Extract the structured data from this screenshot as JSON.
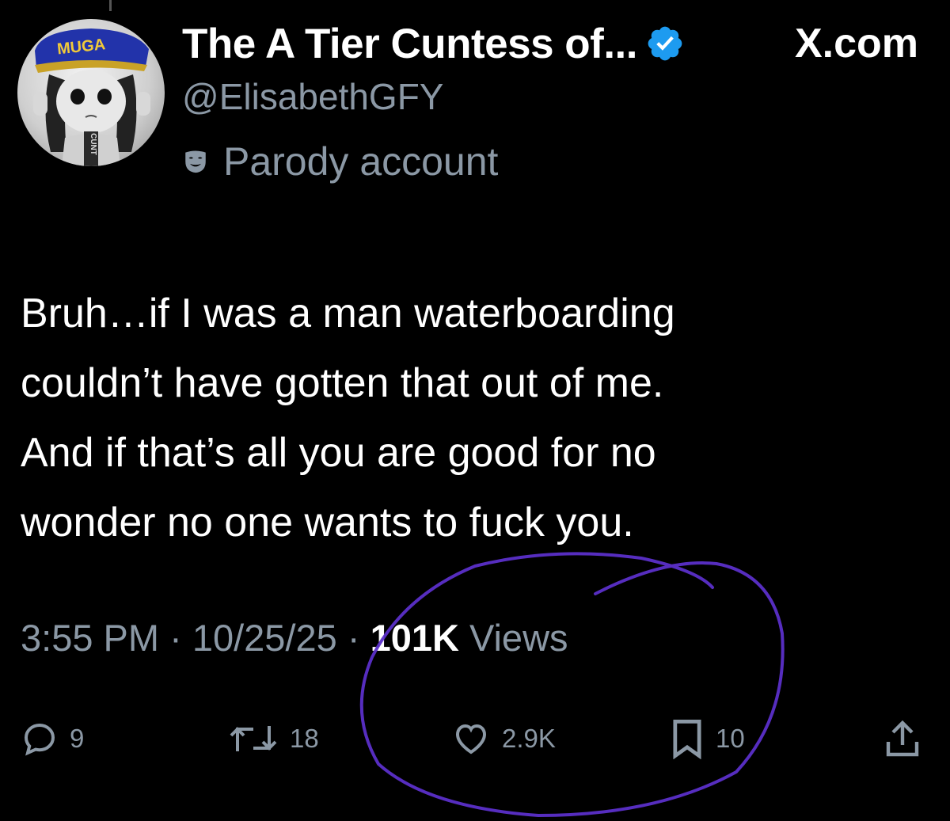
{
  "author": {
    "display_name": "The A Tier Cuntess of...",
    "verified_icon": "verified-badge-icon",
    "handle": "@ElisabethGFY",
    "label": "Parody account",
    "label_icon": "parody-mask-icon",
    "avatar_cap_text": "MUGA",
    "avatar_shirt_text": "CUNT"
  },
  "site": {
    "name": "X.com"
  },
  "tweet": {
    "text": "Bruh…if I was a man waterboarding\ncouldn’t have gotten that out of me.\nAnd if that’s all you are good for no\nwonder no one wants to fuck you.",
    "time": "3:55 PM",
    "separator": "·",
    "date": "10/25/25",
    "views_count": "101K",
    "views_label": "Views"
  },
  "actions": {
    "replies": {
      "icon": "reply-icon",
      "count": "9"
    },
    "reposts": {
      "icon": "repost-icon",
      "count": "18"
    },
    "likes": {
      "icon": "heart-icon",
      "count": "2.9K"
    },
    "bookmarks": {
      "icon": "bookmark-icon",
      "count": "10"
    },
    "share": {
      "icon": "share-icon"
    }
  },
  "colors": {
    "background": "#000000",
    "text": "#ffffff",
    "secondary": "#8b98a5",
    "verified_blue": "#1d9bf0",
    "annotation_purple": "#5b2fc9"
  }
}
